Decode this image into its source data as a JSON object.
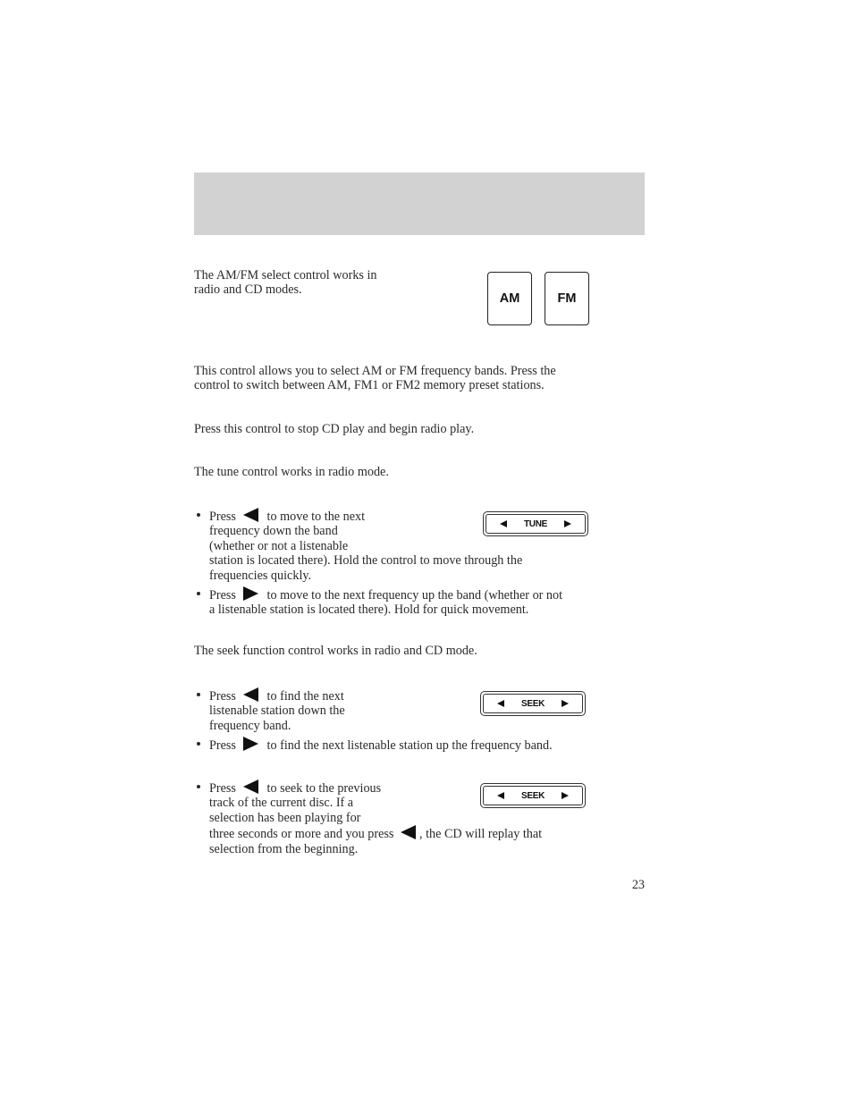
{
  "header": {
    "band_color": "#d2d2d2"
  },
  "amfm": {
    "intro_lines": [
      "The AM/FM select control works in",
      "radio and CD modes."
    ],
    "keys": [
      {
        "label": "AM"
      },
      {
        "label": "FM"
      }
    ],
    "radio_lines": [
      "This control allows you to select AM or FM frequency bands. Press the",
      "control to switch between AM, FM1 or FM2 memory preset stations."
    ],
    "cd_line": "Press this control to stop CD play and begin radio play."
  },
  "tune": {
    "intro": "The tune control works in radio mode.",
    "control_label": "TUNE",
    "bullets": [
      {
        "press": "Press",
        "icon": "left-triangle",
        "lines": [
          "to move to the next",
          "frequency down the band",
          "(whether or not a listenable",
          "station is located there). Hold the control to move through the",
          "frequencies quickly."
        ]
      },
      {
        "press": "Press",
        "icon": "right-triangle",
        "lines": [
          "to move to the next frequency up the band (whether or not",
          "a listenable station is located there). Hold for quick movement."
        ]
      }
    ]
  },
  "seek": {
    "intro": "The seek function control works in radio and CD mode.",
    "control_label": "SEEK",
    "radio_bullets": [
      {
        "press": "Press",
        "icon": "left-triangle",
        "lines": [
          "to find the next",
          "listenable station down the",
          "frequency band."
        ]
      },
      {
        "press": "Press",
        "icon": "right-triangle",
        "lines": [
          "to find the next listenable station up the frequency band."
        ]
      }
    ],
    "cd_bullet": {
      "press": "Press",
      "icon": "left-triangle",
      "lines": [
        "to seek to the previous",
        "track of the current disc. If a",
        "selection has been playing for"
      ],
      "line4_before": "three seconds or more and you press",
      "line4_after": ", the CD will replay that",
      "line5": "selection from the beginning."
    }
  },
  "footer": {
    "page_number": "23"
  }
}
